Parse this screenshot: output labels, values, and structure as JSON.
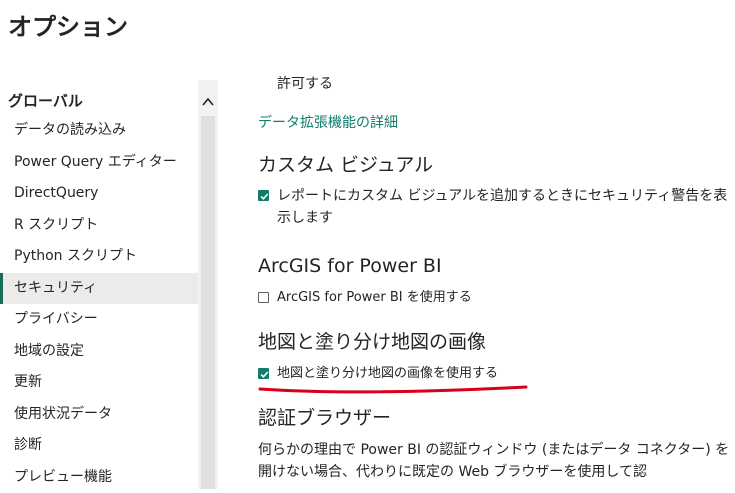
{
  "window": {
    "title": "オプション"
  },
  "sidebar": {
    "section": "グローバル",
    "items": [
      {
        "label": "データの読み込み"
      },
      {
        "label": "Power Query エディター"
      },
      {
        "label": "DirectQuery"
      },
      {
        "label": "R スクリプト"
      },
      {
        "label": "Python スクリプト"
      },
      {
        "label": "セキュリティ",
        "active": true
      },
      {
        "label": "プライバシー"
      },
      {
        "label": "地域の設定"
      },
      {
        "label": "更新"
      },
      {
        "label": "使用状況データ"
      },
      {
        "label": "診断"
      },
      {
        "label": "プレビュー機能"
      }
    ]
  },
  "main": {
    "pre_text": "許可する",
    "link": "データ拡張機能の詳細",
    "custom_visuals": {
      "heading": "カスタム ビジュアル",
      "checkbox_label": "レポートにカスタム ビジュアルを追加するときにセキュリティ警告を表示します",
      "checked": true
    },
    "arcgis": {
      "heading": "ArcGIS for Power BI",
      "checkbox_label": "ArcGIS for Power BI を使用する",
      "checked": false
    },
    "maps": {
      "heading": "地図と塗り分け地図の画像",
      "checkbox_label": "地図と塗り分け地図の画像を使用する",
      "checked": true
    },
    "auth_browser": {
      "heading": "認証ブラウザー",
      "description": "何らかの理由で Power BI の認証ウィンドウ (またはデータ コネクター) を開けない場合、代わりに既定の Web ブラウザーを使用して認"
    }
  },
  "colors": {
    "accent": "#107c6b",
    "annotation": "#d9001b",
    "active_bg": "#edebe9"
  },
  "icons": {
    "scroll_up": "chevron-up-icon",
    "check": "check-icon"
  }
}
